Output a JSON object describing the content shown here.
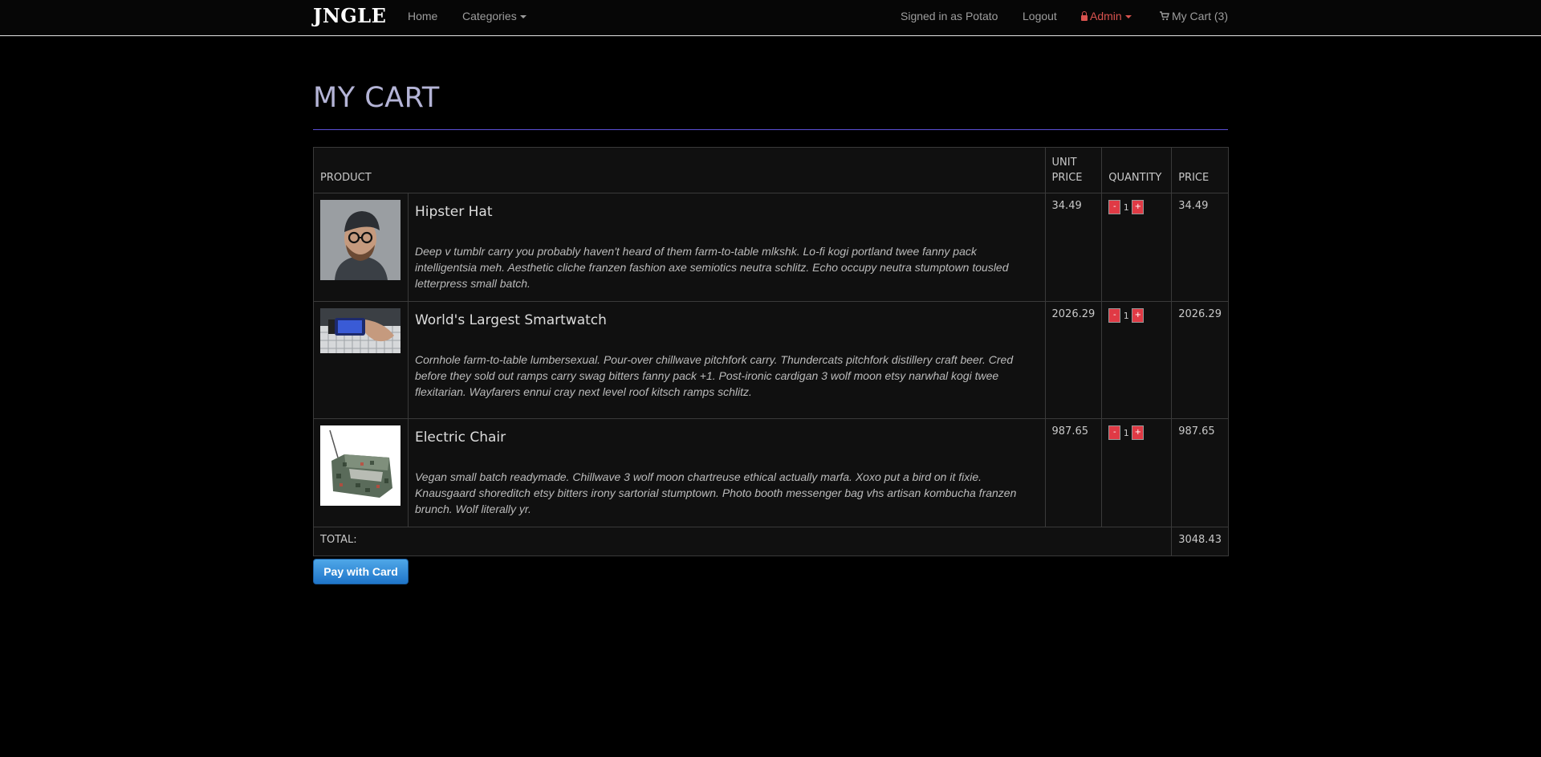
{
  "navbar": {
    "brand": "JNGLE",
    "home": "Home",
    "categories": "Categories",
    "signed_in": "Signed in as Potato",
    "logout": "Logout",
    "admin": "Admin",
    "cart": "My Cart (3)"
  },
  "page": {
    "title": "MY CART"
  },
  "table": {
    "headers": {
      "product": "PRODUCT",
      "unit_price": "UNIT PRICE",
      "quantity": "QUANTITY",
      "price": "PRICE"
    },
    "items": [
      {
        "name": "Hipster Hat",
        "description": "Deep v tumblr carry you probably haven't heard of them farm-to-table mlkshk. Lo-fi kogi portland twee fanny pack intelligentsia meh. Aesthetic cliche franzen fashion axe semiotics neutra schlitz. Echo occupy neutra stumptown tousled letterpress small batch.",
        "unit_price": "34.49",
        "quantity": "1",
        "price": "34.49"
      },
      {
        "name": "World's Largest Smartwatch",
        "description": "Cornhole farm-to-table lumbersexual. Pour-over chillwave pitchfork carry. Thundercats pitchfork distillery craft beer. Cred before they sold out ramps carry swag bitters fanny pack +1. Post-ironic cardigan 3 wolf moon etsy narwhal kogi twee flexitarian. Wayfarers ennui cray next level roof kitsch ramps schlitz.",
        "unit_price": "2026.29",
        "quantity": "1",
        "price": "2026.29"
      },
      {
        "name": "Electric Chair",
        "description": "Vegan small batch readymade. Chillwave 3 wolf moon chartreuse ethical actually marfa. Xoxo put a bird on it fixie. Knausgaard shoreditch etsy bitters irony sartorial stumptown. Photo booth messenger bag vhs artisan kombucha franzen brunch. Wolf literally yr.",
        "unit_price": "987.65",
        "quantity": "1",
        "price": "987.65"
      }
    ],
    "minus": "-",
    "plus": "+",
    "total_label": "TOTAL:",
    "total_value": "3048.43"
  },
  "pay_button": "Pay with Card"
}
